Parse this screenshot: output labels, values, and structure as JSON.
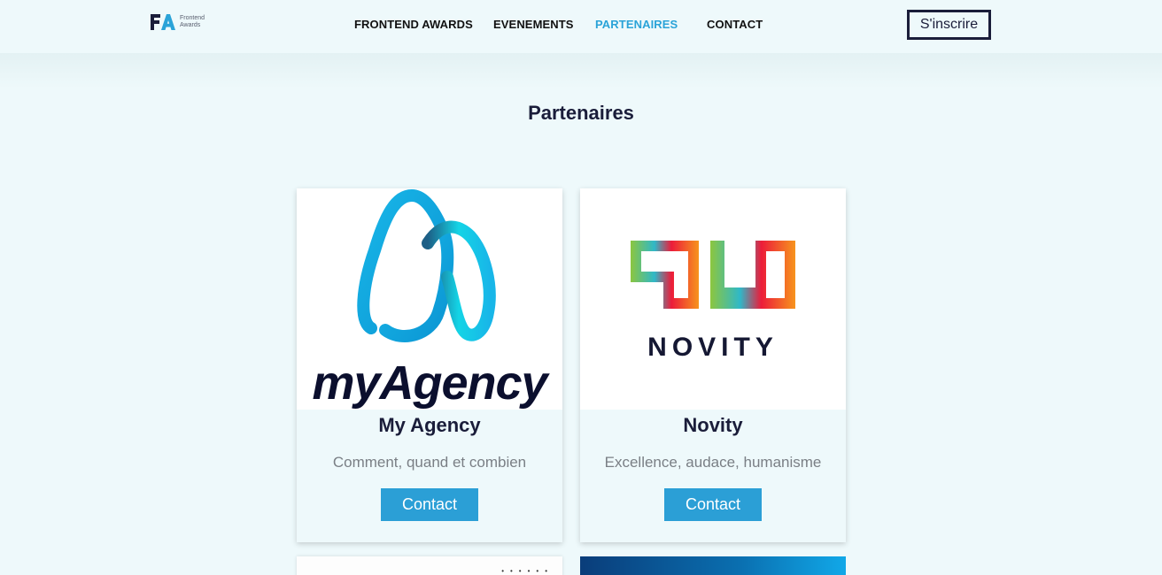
{
  "brand": {
    "initials": "FA",
    "line1": "Frontend",
    "line2": "Awards"
  },
  "nav": {
    "links": [
      {
        "label": "FRONTEND AWARDS",
        "active": false
      },
      {
        "label": "EVENEMENTS",
        "active": false
      },
      {
        "label": "PARTENAIRES",
        "active": true
      },
      {
        "label": "CONTACT",
        "active": false
      }
    ],
    "cta_label": "S'inscrire"
  },
  "page": {
    "title": "Partenaires"
  },
  "partners": [
    {
      "logo_text": "myAgency",
      "name": "My Agency",
      "tagline": "Comment, quand et combien",
      "button_label": "Contact"
    },
    {
      "logo_text": "NOVITY",
      "name": "Novity",
      "tagline": "Excellence, audace, humanisme",
      "button_label": "Contact"
    }
  ],
  "colors": {
    "accent": "#2b9fd6",
    "active_link": "#2aa3d8",
    "text_dark": "#1a1d3a",
    "page_bg": "#eef9fb"
  },
  "icons": [
    "frontend-awards-logo",
    "myagency-logo",
    "novity-logo"
  ]
}
